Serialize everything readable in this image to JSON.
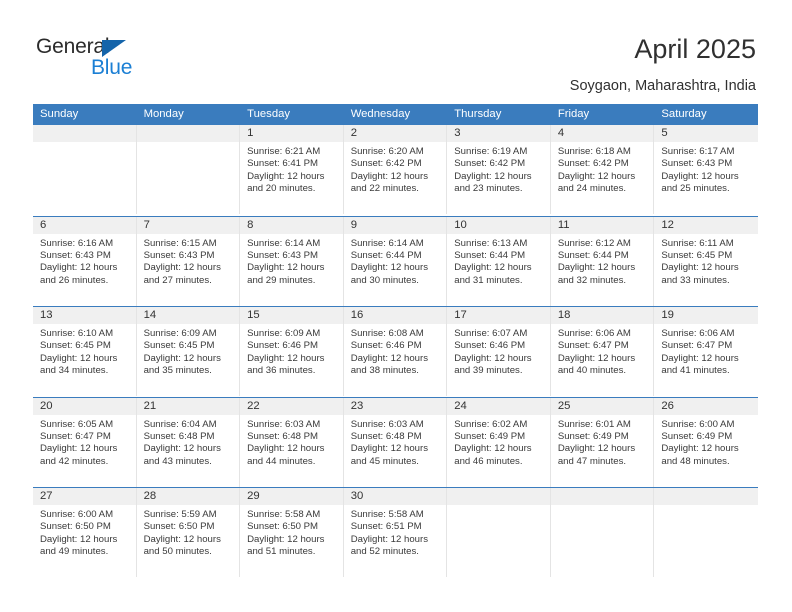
{
  "brand": {
    "name_part1": "General",
    "name_part2": "Blue",
    "logo_icon": "triangle-icon"
  },
  "header": {
    "title": "April 2025",
    "subtitle": "Soygaon, Maharashtra, India"
  },
  "weekdays": [
    "Sunday",
    "Monday",
    "Tuesday",
    "Wednesday",
    "Thursday",
    "Friday",
    "Saturday"
  ],
  "colors": {
    "header_blue": "#3a7cbe",
    "logo_blue": "#1b7fd4",
    "date_band": "#f0f0f0",
    "text": "#3a3a3a"
  },
  "weeks": [
    [
      {
        "date": "",
        "lines": []
      },
      {
        "date": "",
        "lines": []
      },
      {
        "date": "1",
        "lines": [
          "Sunrise: 6:21 AM",
          "Sunset: 6:41 PM",
          "Daylight: 12 hours",
          "and 20 minutes."
        ]
      },
      {
        "date": "2",
        "lines": [
          "Sunrise: 6:20 AM",
          "Sunset: 6:42 PM",
          "Daylight: 12 hours",
          "and 22 minutes."
        ]
      },
      {
        "date": "3",
        "lines": [
          "Sunrise: 6:19 AM",
          "Sunset: 6:42 PM",
          "Daylight: 12 hours",
          "and 23 minutes."
        ]
      },
      {
        "date": "4",
        "lines": [
          "Sunrise: 6:18 AM",
          "Sunset: 6:42 PM",
          "Daylight: 12 hours",
          "and 24 minutes."
        ]
      },
      {
        "date": "5",
        "lines": [
          "Sunrise: 6:17 AM",
          "Sunset: 6:43 PM",
          "Daylight: 12 hours",
          "and 25 minutes."
        ]
      }
    ],
    [
      {
        "date": "6",
        "lines": [
          "Sunrise: 6:16 AM",
          "Sunset: 6:43 PM",
          "Daylight: 12 hours",
          "and 26 minutes."
        ]
      },
      {
        "date": "7",
        "lines": [
          "Sunrise: 6:15 AM",
          "Sunset: 6:43 PM",
          "Daylight: 12 hours",
          "and 27 minutes."
        ]
      },
      {
        "date": "8",
        "lines": [
          "Sunrise: 6:14 AM",
          "Sunset: 6:43 PM",
          "Daylight: 12 hours",
          "and 29 minutes."
        ]
      },
      {
        "date": "9",
        "lines": [
          "Sunrise: 6:14 AM",
          "Sunset: 6:44 PM",
          "Daylight: 12 hours",
          "and 30 minutes."
        ]
      },
      {
        "date": "10",
        "lines": [
          "Sunrise: 6:13 AM",
          "Sunset: 6:44 PM",
          "Daylight: 12 hours",
          "and 31 minutes."
        ]
      },
      {
        "date": "11",
        "lines": [
          "Sunrise: 6:12 AM",
          "Sunset: 6:44 PM",
          "Daylight: 12 hours",
          "and 32 minutes."
        ]
      },
      {
        "date": "12",
        "lines": [
          "Sunrise: 6:11 AM",
          "Sunset: 6:45 PM",
          "Daylight: 12 hours",
          "and 33 minutes."
        ]
      }
    ],
    [
      {
        "date": "13",
        "lines": [
          "Sunrise: 6:10 AM",
          "Sunset: 6:45 PM",
          "Daylight: 12 hours",
          "and 34 minutes."
        ]
      },
      {
        "date": "14",
        "lines": [
          "Sunrise: 6:09 AM",
          "Sunset: 6:45 PM",
          "Daylight: 12 hours",
          "and 35 minutes."
        ]
      },
      {
        "date": "15",
        "lines": [
          "Sunrise: 6:09 AM",
          "Sunset: 6:46 PM",
          "Daylight: 12 hours",
          "and 36 minutes."
        ]
      },
      {
        "date": "16",
        "lines": [
          "Sunrise: 6:08 AM",
          "Sunset: 6:46 PM",
          "Daylight: 12 hours",
          "and 38 minutes."
        ]
      },
      {
        "date": "17",
        "lines": [
          "Sunrise: 6:07 AM",
          "Sunset: 6:46 PM",
          "Daylight: 12 hours",
          "and 39 minutes."
        ]
      },
      {
        "date": "18",
        "lines": [
          "Sunrise: 6:06 AM",
          "Sunset: 6:47 PM",
          "Daylight: 12 hours",
          "and 40 minutes."
        ]
      },
      {
        "date": "19",
        "lines": [
          "Sunrise: 6:06 AM",
          "Sunset: 6:47 PM",
          "Daylight: 12 hours",
          "and 41 minutes."
        ]
      }
    ],
    [
      {
        "date": "20",
        "lines": [
          "Sunrise: 6:05 AM",
          "Sunset: 6:47 PM",
          "Daylight: 12 hours",
          "and 42 minutes."
        ]
      },
      {
        "date": "21",
        "lines": [
          "Sunrise: 6:04 AM",
          "Sunset: 6:48 PM",
          "Daylight: 12 hours",
          "and 43 minutes."
        ]
      },
      {
        "date": "22",
        "lines": [
          "Sunrise: 6:03 AM",
          "Sunset: 6:48 PM",
          "Daylight: 12 hours",
          "and 44 minutes."
        ]
      },
      {
        "date": "23",
        "lines": [
          "Sunrise: 6:03 AM",
          "Sunset: 6:48 PM",
          "Daylight: 12 hours",
          "and 45 minutes."
        ]
      },
      {
        "date": "24",
        "lines": [
          "Sunrise: 6:02 AM",
          "Sunset: 6:49 PM",
          "Daylight: 12 hours",
          "and 46 minutes."
        ]
      },
      {
        "date": "25",
        "lines": [
          "Sunrise: 6:01 AM",
          "Sunset: 6:49 PM",
          "Daylight: 12 hours",
          "and 47 minutes."
        ]
      },
      {
        "date": "26",
        "lines": [
          "Sunrise: 6:00 AM",
          "Sunset: 6:49 PM",
          "Daylight: 12 hours",
          "and 48 minutes."
        ]
      }
    ],
    [
      {
        "date": "27",
        "lines": [
          "Sunrise: 6:00 AM",
          "Sunset: 6:50 PM",
          "Daylight: 12 hours",
          "and 49 minutes."
        ]
      },
      {
        "date": "28",
        "lines": [
          "Sunrise: 5:59 AM",
          "Sunset: 6:50 PM",
          "Daylight: 12 hours",
          "and 50 minutes."
        ]
      },
      {
        "date": "29",
        "lines": [
          "Sunrise: 5:58 AM",
          "Sunset: 6:50 PM",
          "Daylight: 12 hours",
          "and 51 minutes."
        ]
      },
      {
        "date": "30",
        "lines": [
          "Sunrise: 5:58 AM",
          "Sunset: 6:51 PM",
          "Daylight: 12 hours",
          "and 52 minutes."
        ]
      },
      {
        "date": "",
        "lines": []
      },
      {
        "date": "",
        "lines": []
      },
      {
        "date": "",
        "lines": []
      }
    ]
  ]
}
